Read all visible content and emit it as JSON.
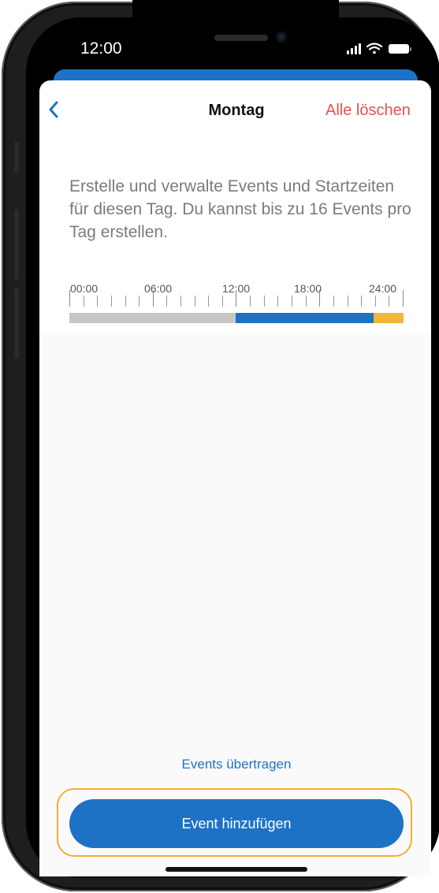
{
  "status_bar": {
    "time": "12:00"
  },
  "header": {
    "title": "Montag",
    "clear_all_label": "Alle löschen"
  },
  "description": "Erstelle und verwalte Events und Startzeiten für diesen Tag. Du kannst bis zu 16 Events pro Tag erstellen.",
  "timeline": {
    "labels": [
      "00:00",
      "06:00",
      "12:00",
      "18:00",
      "24:00"
    ],
    "segments": [
      {
        "from": "00:00",
        "to": "12:00",
        "color": "#c6c6c6"
      },
      {
        "from": "12:00",
        "to": "22:00",
        "color": "#1d72c5"
      },
      {
        "from": "22:00",
        "to": "24:00",
        "color": "#efb637"
      }
    ]
  },
  "actions": {
    "transfer_label": "Events übertragen",
    "add_label": "Event hinzufügen"
  },
  "colors": {
    "accent": "#1d72c5",
    "destructive": "#e25252",
    "highlight": "#f3ad32",
    "evening": "#efb637"
  },
  "icons": {
    "back": "chevron-left-icon",
    "signal": "signal-icon",
    "wifi": "wifi-icon",
    "battery": "battery-icon"
  }
}
